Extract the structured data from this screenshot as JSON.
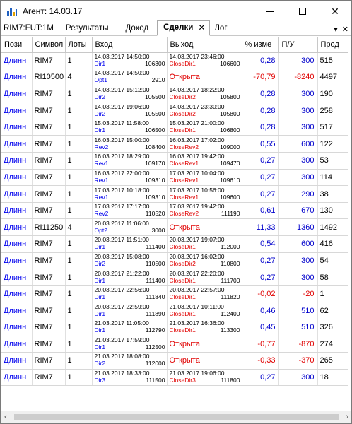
{
  "window": {
    "title": "Агент: 14.03.17"
  },
  "instrument": "RIM7:FUT:1M",
  "tabs": [
    {
      "label": "Результаты",
      "active": false
    },
    {
      "label": "Доход",
      "active": false
    },
    {
      "label": "Сделки",
      "active": true
    },
    {
      "label": "Лог",
      "active": false
    }
  ],
  "columns": [
    "Пози",
    "Символ",
    "Лоты",
    "Вход",
    "Выход",
    "% изме",
    "П/У",
    "Прод"
  ],
  "rows": [
    {
      "pos": "Длинн",
      "sym": "RIM7",
      "lots": "1",
      "in_dt": "14.03.2017 14:50:00",
      "in_sig": "Dir1",
      "in_px": "106300",
      "out_dt": "14.03.2017 23:46:00",
      "out_sig": "CloseDir1",
      "out_px": "106600",
      "pct": "0,28",
      "pl": "300",
      "dur": "515"
    },
    {
      "pos": "Длинн",
      "sym": "RI10500",
      "lots": "4",
      "in_dt": "14.03.2017 14:50:00",
      "in_sig": "Opt1",
      "in_px": "2910",
      "out_open": "Открыта",
      "pct": "-70,79",
      "pl": "-8240",
      "dur": "4497"
    },
    {
      "pos": "Длинн",
      "sym": "RIM7",
      "lots": "1",
      "in_dt": "14.03.2017 15:12:00",
      "in_sig": "Dir2",
      "in_px": "105500",
      "out_dt": "14.03.2017 18:22:00",
      "out_sig": "CloseDir2",
      "out_px": "105800",
      "pct": "0,28",
      "pl": "300",
      "dur": "190"
    },
    {
      "pos": "Длинн",
      "sym": "RIM7",
      "lots": "1",
      "in_dt": "14.03.2017 19:06:00",
      "in_sig": "Dir2",
      "in_px": "105500",
      "out_dt": "14.03.2017 23:30:00",
      "out_sig": "CloseDir2",
      "out_px": "105800",
      "pct": "0,28",
      "pl": "300",
      "dur": "258"
    },
    {
      "pos": "Длинн",
      "sym": "RIM7",
      "lots": "1",
      "in_dt": "15.03.2017 11:58:00",
      "in_sig": "Dir1",
      "in_px": "106500",
      "out_dt": "15.03.2017 21:00:00",
      "out_sig": "CloseDir1",
      "out_px": "106800",
      "pct": "0,28",
      "pl": "300",
      "dur": "517"
    },
    {
      "pos": "Длинн",
      "sym": "RIM7",
      "lots": "1",
      "in_dt": "16.03.2017 15:00:00",
      "in_sig": "Rev2",
      "in_px": "108400",
      "out_dt": "16.03.2017 17:02:00",
      "out_sig": "CloseRev2",
      "out_px": "109000",
      "pct": "0,55",
      "pl": "600",
      "dur": "122"
    },
    {
      "pos": "Длинн",
      "sym": "RIM7",
      "lots": "1",
      "in_dt": "16.03.2017 18:29:00",
      "in_sig": "Rev1",
      "in_px": "109170",
      "out_dt": "16.03.2017 19:42:00",
      "out_sig": "CloseRev1",
      "out_px": "109470",
      "pct": "0,27",
      "pl": "300",
      "dur": "53"
    },
    {
      "pos": "Длинн",
      "sym": "RIM7",
      "lots": "1",
      "in_dt": "16.03.2017 22:00:00",
      "in_sig": "Rev1",
      "in_px": "109310",
      "out_dt": "17.03.2017 10:04:00",
      "out_sig": "CloseRev1",
      "out_px": "109610",
      "pct": "0,27",
      "pl": "300",
      "dur": "114"
    },
    {
      "pos": "Длинн",
      "sym": "RIM7",
      "lots": "1",
      "in_dt": "17.03.2017 10:18:00",
      "in_sig": "Rev1",
      "in_px": "109310",
      "out_dt": "17.03.2017 10:56:00",
      "out_sig": "CloseRev1",
      "out_px": "109600",
      "pct": "0,27",
      "pl": "290",
      "dur": "38"
    },
    {
      "pos": "Длинн",
      "sym": "RIM7",
      "lots": "1",
      "in_dt": "17.03.2017 17:17:00",
      "in_sig": "Rev2",
      "in_px": "110520",
      "out_dt": "17.03.2017 19:42:00",
      "out_sig": "CloseRev2",
      "out_px": "111190",
      "pct": "0,61",
      "pl": "670",
      "dur": "130"
    },
    {
      "pos": "Длинн",
      "sym": "RI11250",
      "lots": "4",
      "in_dt": "20.03.2017 11:06:00",
      "in_sig": "Opt2",
      "in_px": "3000",
      "out_open": "Открыта",
      "pct": "11,33",
      "pl": "1360",
      "dur": "1492"
    },
    {
      "pos": "Длинн",
      "sym": "RIM7",
      "lots": "1",
      "in_dt": "20.03.2017 11:51:00",
      "in_sig": "Dir1",
      "in_px": "111400",
      "out_dt": "20.03.2017 19:07:00",
      "out_sig": "CloseDir1",
      "out_px": "112000",
      "pct": "0,54",
      "pl": "600",
      "dur": "416"
    },
    {
      "pos": "Длинн",
      "sym": "RIM7",
      "lots": "1",
      "in_dt": "20.03.2017 15:08:00",
      "in_sig": "Dir2",
      "in_px": "110500",
      "out_dt": "20.03.2017 16:02:00",
      "out_sig": "CloseDir2",
      "out_px": "110800",
      "pct": "0,27",
      "pl": "300",
      "dur": "54"
    },
    {
      "pos": "Длинн",
      "sym": "RIM7",
      "lots": "1",
      "in_dt": "20.03.2017 21:22:00",
      "in_sig": "Dir1",
      "in_px": "111400",
      "out_dt": "20.03.2017 22:20:00",
      "out_sig": "CloseDir1",
      "out_px": "111700",
      "pct": "0,27",
      "pl": "300",
      "dur": "58"
    },
    {
      "pos": "Длинн",
      "sym": "RIM7",
      "lots": "1",
      "in_dt": "20.03.2017 22:56:00",
      "in_sig": "Dir1",
      "in_px": "111840",
      "out_dt": "20.03.2017 22:57:00",
      "out_sig": "CloseDir1",
      "out_px": "111820",
      "pct": "-0,02",
      "pl": "-20",
      "dur": "1"
    },
    {
      "pos": "Длинн",
      "sym": "RIM7",
      "lots": "1",
      "in_dt": "20.03.2017 22:59:00",
      "in_sig": "Dir1",
      "in_px": "111890",
      "out_dt": "21.03.2017 10:11:00",
      "out_sig": "CloseDir1",
      "out_px": "112400",
      "pct": "0,46",
      "pl": "510",
      "dur": "62"
    },
    {
      "pos": "Длинн",
      "sym": "RIM7",
      "lots": "1",
      "in_dt": "21.03.2017 11:05:00",
      "in_sig": "Dir1",
      "in_px": "112790",
      "out_dt": "21.03.2017 16:36:00",
      "out_sig": "CloseDir1",
      "out_px": "113300",
      "pct": "0,45",
      "pl": "510",
      "dur": "326"
    },
    {
      "pos": "Длинн",
      "sym": "RIM7",
      "lots": "1",
      "in_dt": "21.03.2017 17:59:00",
      "in_sig": "Dir1",
      "in_px": "112500",
      "out_open": "Открыта",
      "pct": "-0,77",
      "pl": "-870",
      "dur": "274"
    },
    {
      "pos": "Длинн",
      "sym": "RIM7",
      "lots": "1",
      "in_dt": "21.03.2017 18:08:00",
      "in_sig": "Dir2",
      "in_px": "112000",
      "out_open": "Открыта",
      "pct": "-0,33",
      "pl": "-370",
      "dur": "265"
    },
    {
      "pos": "Длинн",
      "sym": "RIM7",
      "lots": "1",
      "in_dt": "21.03.2017 18:33:00",
      "in_sig": "Dir3",
      "in_px": "111500",
      "out_dt": "21.03.2017 19:06:00",
      "out_sig": "CloseDir3",
      "out_px": "111800",
      "pct": "0,27",
      "pl": "300",
      "dur": "18"
    }
  ],
  "colors": {
    "positive": "#0000cc",
    "negative": "#e00000",
    "link": "#0000ee"
  }
}
